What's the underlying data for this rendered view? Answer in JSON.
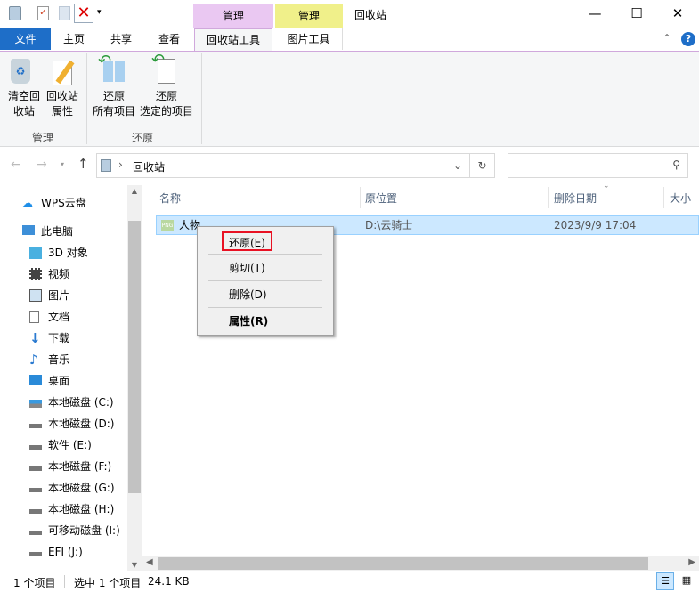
{
  "title": "回收站",
  "contextual_tabs": [
    {
      "label": "管理",
      "color": "#eac8f2"
    },
    {
      "label": "管理",
      "color": "#f0f08a"
    }
  ],
  "tabs": [
    "文件",
    "主页",
    "共享",
    "查看",
    "回收站工具",
    "图片工具"
  ],
  "ribbon": {
    "groups": [
      {
        "label": "管理",
        "buttons": [
          "清空回\n收站",
          "回收站\n属性"
        ]
      },
      {
        "label": "还原",
        "buttons": [
          "还原\n所有项目",
          "还原\n选定的项目"
        ]
      }
    ],
    "empty_l1": "清空回",
    "empty_l2": "收站",
    "props_l1": "回收站",
    "props_l2": "属性",
    "restore_all_l1": "还原",
    "restore_all_l2": "所有项目",
    "restore_sel_l1": "还原",
    "restore_sel_l2": "选定的项目"
  },
  "address": {
    "path": "回收站",
    "search_placeholder": ""
  },
  "sidebar": [
    "WPS云盘",
    "此电脑",
    "3D 对象",
    "视频",
    "图片",
    "文档",
    "下载",
    "音乐",
    "桌面",
    "本地磁盘 (C:)",
    "本地磁盘 (D:)",
    "软件 (E:)",
    "本地磁盘 (F:)",
    "本地磁盘 (G:)",
    "本地磁盘 (H:)",
    "可移动磁盘 (I:)",
    "EFI (J:)"
  ],
  "columns": [
    "名称",
    "原位置",
    "删除日期",
    "大小"
  ],
  "files": [
    {
      "name": "人物",
      "location": "D:\\云骑士",
      "date": "2023/9/9 17:04"
    }
  ],
  "context_menu": [
    "还原(E)",
    "剪切(T)",
    "删除(D)",
    "属性(R)"
  ],
  "status": {
    "count": "1 个项目",
    "selected": "选中 1 个项目",
    "size": "24.1 KB"
  },
  "colors": {
    "file_tab": "#1e6ec8",
    "selection": "#cce8ff",
    "highlight": "#e81123"
  }
}
